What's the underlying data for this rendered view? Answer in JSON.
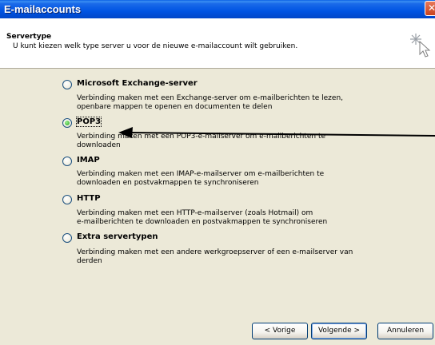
{
  "window": {
    "title": "E-mailaccounts",
    "close_glyph": "✕"
  },
  "header": {
    "title": "Servertype",
    "subtitle": "U kunt kiezen welk type server u voor de nieuwe e-mailaccount wilt gebruiken.",
    "icon": "wizard-sparkle-cursor-icon"
  },
  "options": [
    {
      "label": "Microsoft Exchange-server",
      "desc1": "Verbinding maken met een Exchange-server om e-mailberichten te lezen,",
      "desc2": "openbare mappen te openen en documenten te delen",
      "selected": false
    },
    {
      "label": "POP3",
      "desc1": "Verbinding maken met een POP3-e-mailserver om e-mailberichten te",
      "desc2": "downloaden",
      "selected": true
    },
    {
      "label": "IMAP",
      "desc1": "Verbinding maken met een IMAP-e-mailserver om e-mailberichten te",
      "desc2": "downloaden en postvakmappen te synchroniseren",
      "selected": false
    },
    {
      "label": "HTTP",
      "desc1": "Verbinding maken met een HTTP-e-mailserver (zoals Hotmail) om",
      "desc2": "e-mailberichten te downloaden en postvakmappen te synchroniseren",
      "selected": false
    },
    {
      "label": "Extra servertypen",
      "desc1": "Verbinding maken met een andere werkgroepserver of een e-mailserver van",
      "desc2": "derden",
      "selected": false
    }
  ],
  "buttons": {
    "back": "< Vorige",
    "next": "Volgende >",
    "cancel": "Annuleren"
  },
  "colors": {
    "title_bar": "#0054e3",
    "dialog_bg": "#ece9d8",
    "radio_selected": "#21a121"
  }
}
